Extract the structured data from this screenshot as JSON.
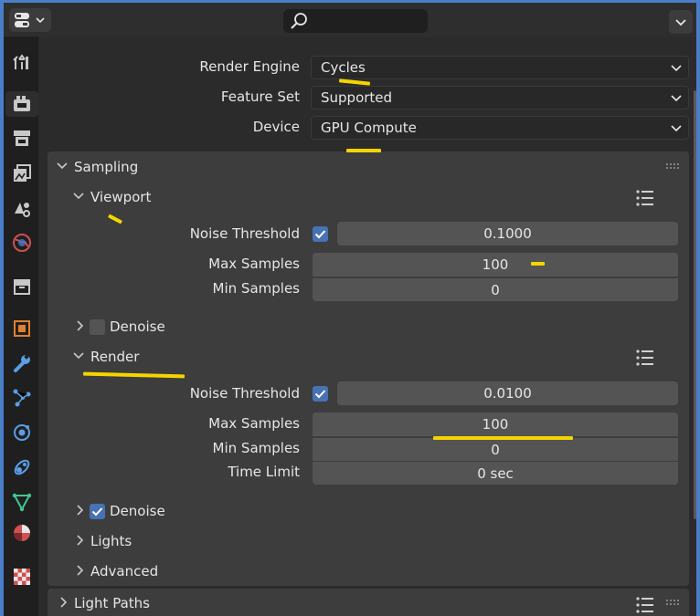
{
  "header": {
    "search_icon": "search-icon"
  },
  "sidebar": {
    "items": [
      {
        "name": "tool",
        "color": "#c8c8c8"
      },
      {
        "name": "render",
        "color": "#c8c8c8"
      },
      {
        "name": "output",
        "color": "#c8c8c8"
      },
      {
        "name": "view-layer",
        "color": "#c8c8c8"
      },
      {
        "name": "scene",
        "color": "#c8c8c8"
      },
      {
        "name": "world",
        "color": "#d05050"
      },
      {
        "name": "collection",
        "color": "#c8c8c8"
      },
      {
        "name": "object",
        "color": "#e08030"
      },
      {
        "name": "modifiers",
        "color": "#5a9ee8"
      },
      {
        "name": "particles",
        "color": "#5a9ee8"
      },
      {
        "name": "physics",
        "color": "#5a9ee8"
      },
      {
        "name": "constraints",
        "color": "#5a9ee8"
      },
      {
        "name": "object-data",
        "color": "#40c890"
      },
      {
        "name": "material",
        "color": "#d05050"
      },
      {
        "name": "texture",
        "color": "#d05050"
      }
    ]
  },
  "render": {
    "engine_label": "Render Engine",
    "engine_value": "Cycles",
    "feature_set_label": "Feature Set",
    "feature_set_value": "Supported",
    "device_label": "Device",
    "device_value": "GPU Compute"
  },
  "sampling": {
    "title": "Sampling",
    "viewport": {
      "title": "Viewport",
      "noise_threshold_label": "Noise Threshold",
      "noise_threshold_value": "0.1000",
      "noise_threshold_enabled": true,
      "max_samples_label": "Max Samples",
      "max_samples_value": "100",
      "min_samples_label": "Min Samples",
      "min_samples_value": "0",
      "denoise_label": "Denoise",
      "denoise_enabled": false
    },
    "render": {
      "title": "Render",
      "noise_threshold_label": "Noise Threshold",
      "noise_threshold_value": "0.0100",
      "noise_threshold_enabled": true,
      "max_samples_label": "Max Samples",
      "max_samples_value": "100",
      "min_samples_label": "Min Samples",
      "min_samples_value": "0",
      "time_limit_label": "Time Limit",
      "time_limit_value": "0 sec",
      "denoise_label": "Denoise",
      "denoise_enabled": true
    },
    "lights_label": "Lights",
    "advanced_label": "Advanced"
  },
  "light_paths": {
    "title": "Light Paths"
  },
  "colors": {
    "accent": "#4772b3",
    "highlight": "#f5d400"
  }
}
